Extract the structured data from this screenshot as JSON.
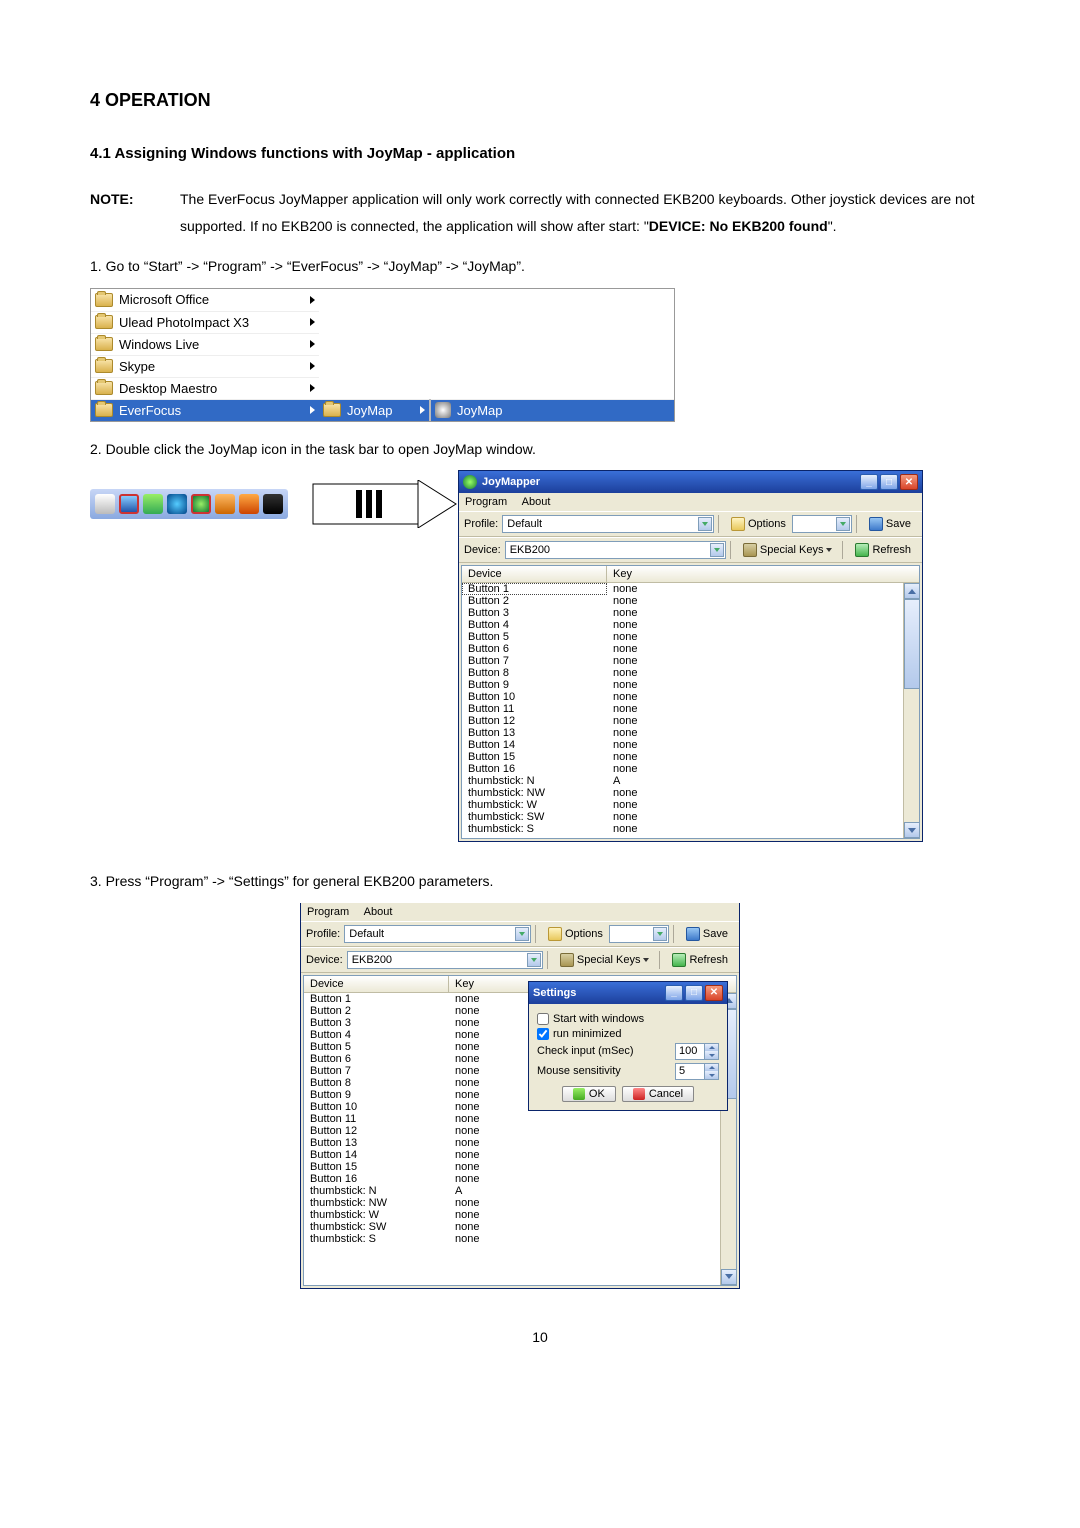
{
  "title": "4 OPERATION",
  "section41": "4.1   Assigning Windows functions with JoyMap - application",
  "note": {
    "label": "NOTE:",
    "line1": "The EverFocus JoyMapper application will only work correctly with connected EKB200 keyboards. Other joystick devices are not supported. If no EKB200 is connected, the application will show after start: \"",
    "device_bold": "DEVICE:   No EKB200 found",
    "line1_end": "\"."
  },
  "step1": "1. Go to “Start” -> “Program” -> “EverFocus” -> “JoyMap” -> “JoyMap”.",
  "start_menu": {
    "items": [
      "Microsoft Office",
      "Ulead PhotoImpact X3",
      "Windows Live",
      "Skype",
      "Desktop Maestro",
      "EverFocus"
    ],
    "sub1": "JoyMap",
    "sub2": "JoyMap"
  },
  "step2": "2. Double click the JoyMap icon in the task bar to open JoyMap window.",
  "joymapper": {
    "title": "JoyMapper",
    "menu_program": "Program",
    "menu_about": "About",
    "profile_label": "Profile:",
    "profile_value": "Default",
    "options_label": "Options",
    "save_label": "Save",
    "device_label": "Device:",
    "device_value": "EKB200",
    "special_label": "Special Keys",
    "refresh_label": "Refresh",
    "col_device": "Device",
    "col_key": "Key",
    "rows": [
      [
        "Button 1",
        "none"
      ],
      [
        "Button 2",
        "none"
      ],
      [
        "Button 3",
        "none"
      ],
      [
        "Button 4",
        "none"
      ],
      [
        "Button 5",
        "none"
      ],
      [
        "Button 6",
        "none"
      ],
      [
        "Button 7",
        "none"
      ],
      [
        "Button 8",
        "none"
      ],
      [
        "Button 9",
        "none"
      ],
      [
        "Button 10",
        "none"
      ],
      [
        "Button 11",
        "none"
      ],
      [
        "Button 12",
        "none"
      ],
      [
        "Button 13",
        "none"
      ],
      [
        "Button 14",
        "none"
      ],
      [
        "Button 15",
        "none"
      ],
      [
        "Button 16",
        "none"
      ],
      [
        "thumbstick: N",
        "A"
      ],
      [
        "thumbstick: NW",
        "none"
      ],
      [
        "thumbstick: W",
        "none"
      ],
      [
        "thumbstick: SW",
        "none"
      ],
      [
        "thumbstick: S",
        "none"
      ]
    ]
  },
  "step3": "3. Press “Program” -> “Settings” for general EKB200 parameters.",
  "settings": {
    "title": "Settings",
    "start_windows": "Start with windows",
    "run_min": "run minimized",
    "check_input": "Check input (mSec)",
    "check_val": "100",
    "mouse_sens": "Mouse sensitivity",
    "mouse_val": "5",
    "ok": "OK",
    "cancel": "Cancel"
  },
  "page": "10"
}
